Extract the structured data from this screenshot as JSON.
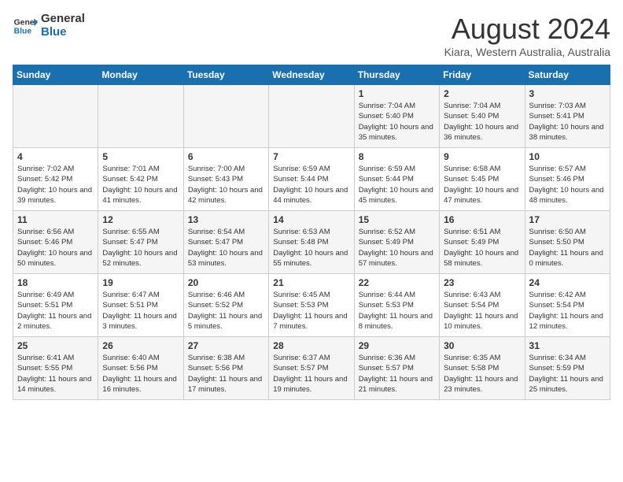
{
  "header": {
    "logo_line1": "General",
    "logo_line2": "Blue",
    "month_title": "August 2024",
    "location": "Kiara, Western Australia, Australia"
  },
  "days_of_week": [
    "Sunday",
    "Monday",
    "Tuesday",
    "Wednesday",
    "Thursday",
    "Friday",
    "Saturday"
  ],
  "weeks": [
    [
      {
        "day": "",
        "empty": true
      },
      {
        "day": "",
        "empty": true
      },
      {
        "day": "",
        "empty": true
      },
      {
        "day": "",
        "empty": true
      },
      {
        "day": "1",
        "sunrise": "7:04 AM",
        "sunset": "5:40 PM",
        "daylight": "10 hours and 35 minutes."
      },
      {
        "day": "2",
        "sunrise": "7:04 AM",
        "sunset": "5:40 PM",
        "daylight": "10 hours and 36 minutes."
      },
      {
        "day": "3",
        "sunrise": "7:03 AM",
        "sunset": "5:41 PM",
        "daylight": "10 hours and 38 minutes."
      }
    ],
    [
      {
        "day": "4",
        "sunrise": "7:02 AM",
        "sunset": "5:42 PM",
        "daylight": "10 hours and 39 minutes."
      },
      {
        "day": "5",
        "sunrise": "7:01 AM",
        "sunset": "5:42 PM",
        "daylight": "10 hours and 41 minutes."
      },
      {
        "day": "6",
        "sunrise": "7:00 AM",
        "sunset": "5:43 PM",
        "daylight": "10 hours and 42 minutes."
      },
      {
        "day": "7",
        "sunrise": "6:59 AM",
        "sunset": "5:44 PM",
        "daylight": "10 hours and 44 minutes."
      },
      {
        "day": "8",
        "sunrise": "6:59 AM",
        "sunset": "5:44 PM",
        "daylight": "10 hours and 45 minutes."
      },
      {
        "day": "9",
        "sunrise": "6:58 AM",
        "sunset": "5:45 PM",
        "daylight": "10 hours and 47 minutes."
      },
      {
        "day": "10",
        "sunrise": "6:57 AM",
        "sunset": "5:46 PM",
        "daylight": "10 hours and 48 minutes."
      }
    ],
    [
      {
        "day": "11",
        "sunrise": "6:56 AM",
        "sunset": "5:46 PM",
        "daylight": "10 hours and 50 minutes."
      },
      {
        "day": "12",
        "sunrise": "6:55 AM",
        "sunset": "5:47 PM",
        "daylight": "10 hours and 52 minutes."
      },
      {
        "day": "13",
        "sunrise": "6:54 AM",
        "sunset": "5:47 PM",
        "daylight": "10 hours and 53 minutes."
      },
      {
        "day": "14",
        "sunrise": "6:53 AM",
        "sunset": "5:48 PM",
        "daylight": "10 hours and 55 minutes."
      },
      {
        "day": "15",
        "sunrise": "6:52 AM",
        "sunset": "5:49 PM",
        "daylight": "10 hours and 57 minutes."
      },
      {
        "day": "16",
        "sunrise": "6:51 AM",
        "sunset": "5:49 PM",
        "daylight": "10 hours and 58 minutes."
      },
      {
        "day": "17",
        "sunrise": "6:50 AM",
        "sunset": "5:50 PM",
        "daylight": "11 hours and 0 minutes."
      }
    ],
    [
      {
        "day": "18",
        "sunrise": "6:49 AM",
        "sunset": "5:51 PM",
        "daylight": "11 hours and 2 minutes."
      },
      {
        "day": "19",
        "sunrise": "6:47 AM",
        "sunset": "5:51 PM",
        "daylight": "11 hours and 3 minutes."
      },
      {
        "day": "20",
        "sunrise": "6:46 AM",
        "sunset": "5:52 PM",
        "daylight": "11 hours and 5 minutes."
      },
      {
        "day": "21",
        "sunrise": "6:45 AM",
        "sunset": "5:53 PM",
        "daylight": "11 hours and 7 minutes."
      },
      {
        "day": "22",
        "sunrise": "6:44 AM",
        "sunset": "5:53 PM",
        "daylight": "11 hours and 8 minutes."
      },
      {
        "day": "23",
        "sunrise": "6:43 AM",
        "sunset": "5:54 PM",
        "daylight": "11 hours and 10 minutes."
      },
      {
        "day": "24",
        "sunrise": "6:42 AM",
        "sunset": "5:54 PM",
        "daylight": "11 hours and 12 minutes."
      }
    ],
    [
      {
        "day": "25",
        "sunrise": "6:41 AM",
        "sunset": "5:55 PM",
        "daylight": "11 hours and 14 minutes."
      },
      {
        "day": "26",
        "sunrise": "6:40 AM",
        "sunset": "5:56 PM",
        "daylight": "11 hours and 16 minutes."
      },
      {
        "day": "27",
        "sunrise": "6:38 AM",
        "sunset": "5:56 PM",
        "daylight": "11 hours and 17 minutes."
      },
      {
        "day": "28",
        "sunrise": "6:37 AM",
        "sunset": "5:57 PM",
        "daylight": "11 hours and 19 minutes."
      },
      {
        "day": "29",
        "sunrise": "6:36 AM",
        "sunset": "5:57 PM",
        "daylight": "11 hours and 21 minutes."
      },
      {
        "day": "30",
        "sunrise": "6:35 AM",
        "sunset": "5:58 PM",
        "daylight": "11 hours and 23 minutes."
      },
      {
        "day": "31",
        "sunrise": "6:34 AM",
        "sunset": "5:59 PM",
        "daylight": "11 hours and 25 minutes."
      }
    ]
  ]
}
